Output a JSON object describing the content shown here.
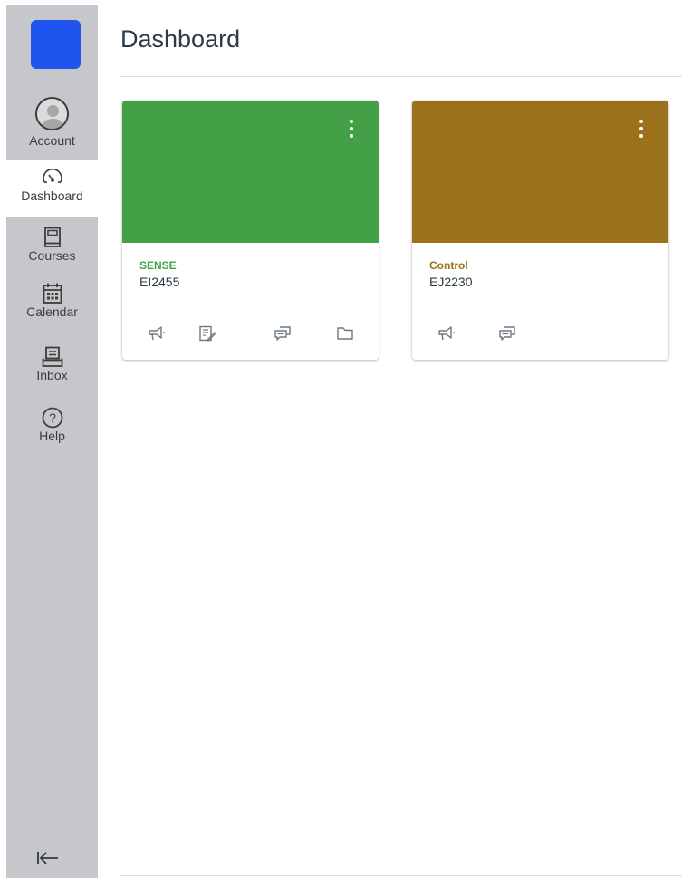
{
  "nav": {
    "items": [
      {
        "id": "account",
        "label": "Account"
      },
      {
        "id": "dashboard",
        "label": "Dashboard"
      },
      {
        "id": "courses",
        "label": "Courses"
      },
      {
        "id": "calendar",
        "label": "Calendar"
      },
      {
        "id": "inbox",
        "label": "Inbox"
      },
      {
        "id": "help",
        "label": "Help"
      }
    ],
    "logo_color": "#1f55ee",
    "background": "#c7c7cb",
    "collapse_icon": "collapse-nav-icon"
  },
  "page": {
    "title": "Dashboard"
  },
  "cards": [
    {
      "name": "SENSE",
      "code": "EI2455",
      "color": "#44a047",
      "actions": [
        "announcements-icon",
        "assignments-icon",
        "discussions-icon",
        "files-icon"
      ]
    },
    {
      "name": "Control",
      "code": "EJ2230",
      "color": "#9c711b",
      "actions": [
        "announcements-icon",
        "discussions-icon"
      ]
    }
  ]
}
